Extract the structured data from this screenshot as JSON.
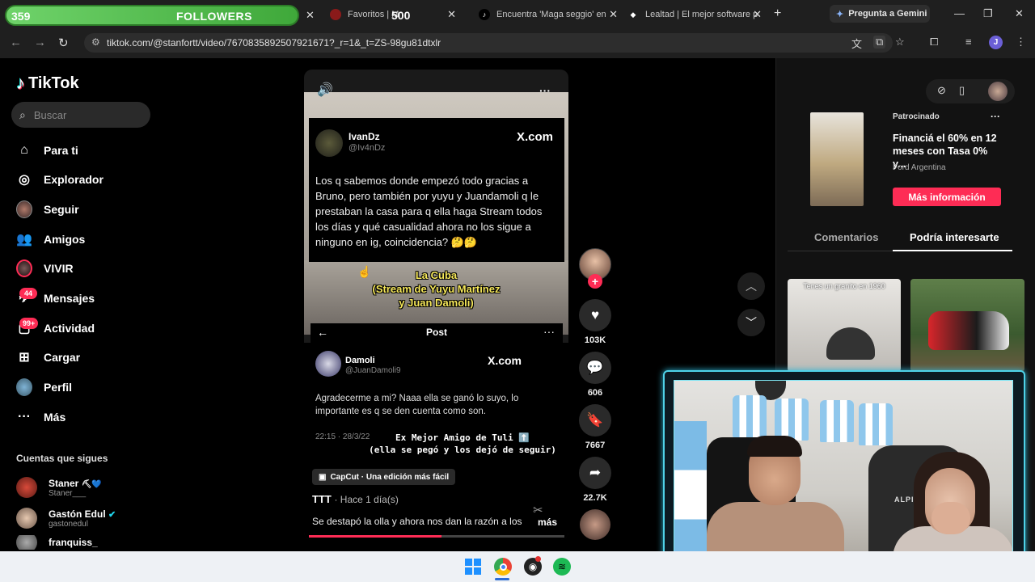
{
  "overlay": {
    "followers_count": "359",
    "followers_label": "FOLLOWERS",
    "goal": "500"
  },
  "browser": {
    "tabs": [
      {
        "label": "Favoritos | M",
        "icon": "tab-favicon-red"
      },
      {
        "label": "Encuentra 'Maga seggio' en",
        "icon": "tiktok-icon"
      },
      {
        "label": "Lealtad | El mejor software p",
        "icon": "diamond-icon"
      }
    ],
    "gemini_label": "Pregunta a Gemini",
    "url": "tiktok.com/@stanfortt/video/7670835892507921671?_r=1&_t=ZS-98gu81dtxlr",
    "profile_initial": "J"
  },
  "sidebar": {
    "logo": "TikTok",
    "search_placeholder": "Buscar",
    "items": [
      {
        "label": "Para ti",
        "icon": "home-icon"
      },
      {
        "label": "Explorador",
        "icon": "compass-icon"
      },
      {
        "label": "Seguir",
        "icon": "following-avatar-icon"
      },
      {
        "label": "Amigos",
        "icon": "friends-icon"
      },
      {
        "label": "VIVIR",
        "icon": "live-icon"
      },
      {
        "label": "Mensajes",
        "icon": "messages-icon",
        "badge": "44"
      },
      {
        "label": "Actividad",
        "icon": "activity-icon",
        "badge": "99+"
      },
      {
        "label": "Cargar",
        "icon": "upload-icon"
      },
      {
        "label": "Perfil",
        "icon": "profile-avatar-icon"
      },
      {
        "label": "Más",
        "icon": "more-icon"
      }
    ],
    "following_title": "Cuentas que sigues",
    "accounts": [
      {
        "name": "Staner",
        "handle": "Staner___"
      },
      {
        "name": "Gastón Edul",
        "handle": "gastonedul"
      },
      {
        "name": "franquiss_",
        "handle": ""
      }
    ]
  },
  "video": {
    "tweet1": {
      "name": "IvanDz",
      "handle": "@Iv4nDz",
      "source": "X.com",
      "text": "Los q sabemos donde empezó todo gracias a Bruno, pero también por yuyu y Juandamoli q le prestaban la casa para q ella haga Stream todos los días y qué casualidad ahora no los sigue a ninguno en ig, coincidencia? 🤔🤔"
    },
    "caption_line1": "La Cuba",
    "caption_line2": "(Stream de Yuyu Martínez",
    "caption_line3": "y Juan Damoli)",
    "post_title": "Post",
    "tweet2": {
      "name": "Damoli",
      "handle": "@JuanDamoli9",
      "source": "X.com",
      "text": "Agradecerme a mi? Naaa ella se ganó lo suyo, lo importante es q se den cuenta como son.",
      "date": "22:15 · 28/3/22"
    },
    "overlay2_line1": "Ex Mejor Amigo de Tuli ⬆️",
    "overlay2_line2": "(ella se pegó y los dejó de seguir)",
    "capcut_label": "CapCut · Una edición más fácil",
    "author": "TTT",
    "ago": "· Hace 1 día(s)",
    "description": "Se destapó la olla y ahora nos dan la razón a los",
    "more_label": "más",
    "progress": 0.52
  },
  "actions": {
    "likes": "103K",
    "comments": "606",
    "saves": "7667",
    "shares": "22.7K"
  },
  "right": {
    "sponsored_label": "Patrocinado",
    "ad_title": "Financiá el 60% en 12 meses con Tasa 0% y...",
    "ad_brand": "Ford Argentina",
    "ad_button": "Más información",
    "tabs": [
      "Comentarios",
      "Podría interesarte"
    ],
    "thumb1_caption": "Tenes un granito en 1960"
  },
  "webcam": {
    "chair_brand": "ALPINA"
  }
}
